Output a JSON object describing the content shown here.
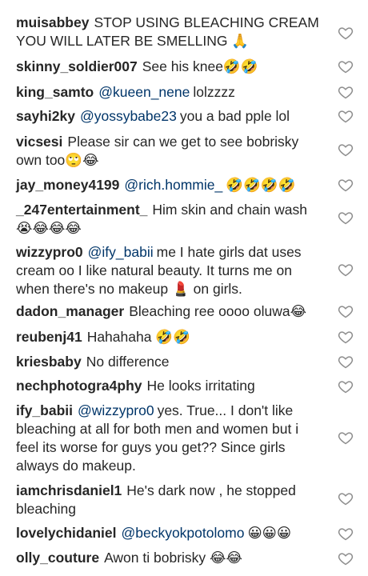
{
  "comments": [
    {
      "username": "muisabbey",
      "mention": "",
      "text": "STOP USING BLEACHING CREAM YOU WILL LATER BE SMELLING 🙏"
    },
    {
      "username": "skinny_soldier007",
      "mention": "",
      "text": "See his knee🤣🤣"
    },
    {
      "username": "king_samto",
      "mention": "@kueen_nene",
      "text": "lolzzzz"
    },
    {
      "username": "sayhi2ky",
      "mention": "@yossybabe23",
      "text": "you a bad pple lol"
    },
    {
      "username": "vicsesi",
      "mention": "",
      "text": "Please sir can we get to see bobrisky own too🙄😂"
    },
    {
      "username": "jay_money4199",
      "mention": "@rich.hommie_",
      "text": "🤣🤣🤣🤣"
    },
    {
      "username": "_247entertainment_",
      "mention": "",
      "text": "Him skin and chain wash 😭😂😂😂"
    },
    {
      "username": "wizzypro0",
      "mention": "@ify_babii",
      "text": "me I hate girls dat uses cream oo I like natural beauty. It turns me on when there's no makeup 💄 on girls."
    },
    {
      "username": "dadon_manager",
      "mention": "",
      "text": "Bleaching ree oooo oluwa😂"
    },
    {
      "username": "reubenj41",
      "mention": "",
      "text": "Hahahaha 🤣🤣"
    },
    {
      "username": "kriesbaby",
      "mention": "",
      "text": "No difference"
    },
    {
      "username": "nechphotogra4phy",
      "mention": "",
      "text": "He looks irritating"
    },
    {
      "username": "ify_babii",
      "mention": "@wizzypro0",
      "text": "yes. True... I don't like bleaching at all for both men and women but i feel its worse for guys you get?? Since girls always do makeup."
    },
    {
      "username": "iamchrisdaniel1",
      "mention": "",
      "text": "He's dark now , he stopped bleaching"
    },
    {
      "username": "lovelychidaniel",
      "mention": "@beckyokpotolomo",
      "text": "😀😀😀"
    },
    {
      "username": "olly_couture",
      "mention": "",
      "text": "Awon ti bobrisky 😂😂"
    }
  ],
  "icons": {
    "like": "heart-outline-icon"
  },
  "colors": {
    "text": "#262626",
    "mention": "#003569",
    "icon": "#8e8e8e"
  }
}
